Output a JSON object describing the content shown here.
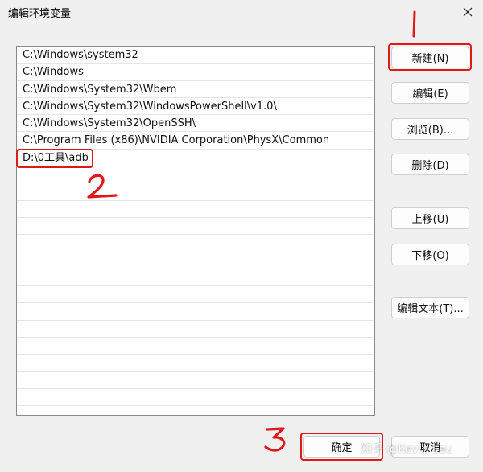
{
  "window": {
    "title": "编辑环境变量"
  },
  "paths": [
    "C:\\Windows\\system32",
    "C:\\Windows",
    "C:\\Windows\\System32\\Wbem",
    "C:\\Windows\\System32\\WindowsPowerShell\\v1.0\\",
    "C:\\Windows\\System32\\OpenSSH\\",
    "C:\\Program Files (x86)\\NVIDIA Corporation\\PhysX\\Common",
    "D:\\0工具\\adb"
  ],
  "buttons": {
    "new": "新建(N)",
    "edit": "编辑(E)",
    "browse": "浏览(B)...",
    "delete": "删除(D)",
    "move_up": "上移(U)",
    "move_down": "下移(O)",
    "edit_text": "编辑文本(T)...",
    "ok": "确定",
    "cancel": "取消"
  },
  "annotations": {
    "step1": "1",
    "step2": "2",
    "step3": "3",
    "color": "#e01818"
  },
  "watermark": "知乎 @Kevin Lau"
}
